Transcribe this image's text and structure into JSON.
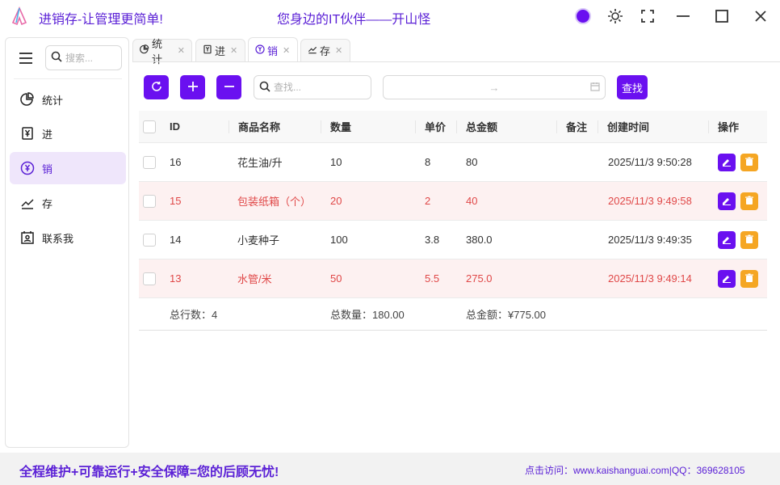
{
  "titlebar": {
    "app_title": "进销存-让管理更简单!",
    "slogan": "您身边的IT伙伴——开山怪",
    "theme_color": "#6a10f0"
  },
  "sidebar": {
    "search_placeholder": "搜索...",
    "items": [
      {
        "label": "统计",
        "icon": "pie-chart-icon"
      },
      {
        "label": "进",
        "icon": "yen-box-icon"
      },
      {
        "label": "销",
        "icon": "yen-circle-icon",
        "active": true
      },
      {
        "label": "存",
        "icon": "trend-line-icon"
      },
      {
        "label": "联系我",
        "icon": "contact-card-icon"
      }
    ]
  },
  "tabs": [
    {
      "label": "统计"
    },
    {
      "label": "进"
    },
    {
      "label": "销",
      "active": true
    },
    {
      "label": "存"
    }
  ],
  "toolbar": {
    "find_placeholder": "查找...",
    "search_label": "查找",
    "date_arrow": "→"
  },
  "table": {
    "headers": [
      "ID",
      "商品名称",
      "数量",
      "单价",
      "总金额",
      "备注",
      "创建时间",
      "操作"
    ],
    "rows": [
      {
        "id": "16",
        "name": "花生油/升",
        "qty": "10",
        "price": "8",
        "total": "80",
        "note": "",
        "time": "2025/11/3 9:50:28",
        "warn": false
      },
      {
        "id": "15",
        "name": "包装纸箱（个）",
        "qty": "20",
        "price": "2",
        "total": "40",
        "note": "",
        "time": "2025/11/3 9:49:58",
        "warn": true
      },
      {
        "id": "14",
        "name": "小麦种子",
        "qty": "100",
        "price": "3.8",
        "total": "380.0",
        "note": "",
        "time": "2025/11/3 9:49:35",
        "warn": false
      },
      {
        "id": "13",
        "name": "水管/米",
        "qty": "50",
        "price": "5.5",
        "total": "275.0",
        "note": "",
        "time": "2025/11/3 9:49:14",
        "warn": true
      }
    ],
    "footer": {
      "row_count": "总行数：4",
      "total_qty": "总数量：180.00",
      "total_amount": "总金额：¥775.00"
    }
  },
  "bottombar": {
    "left": "全程维护+可靠运行+安全保障=您的后顾无忧!",
    "right": "点击访问：www.kaishanguai.com|QQ：369628105"
  }
}
